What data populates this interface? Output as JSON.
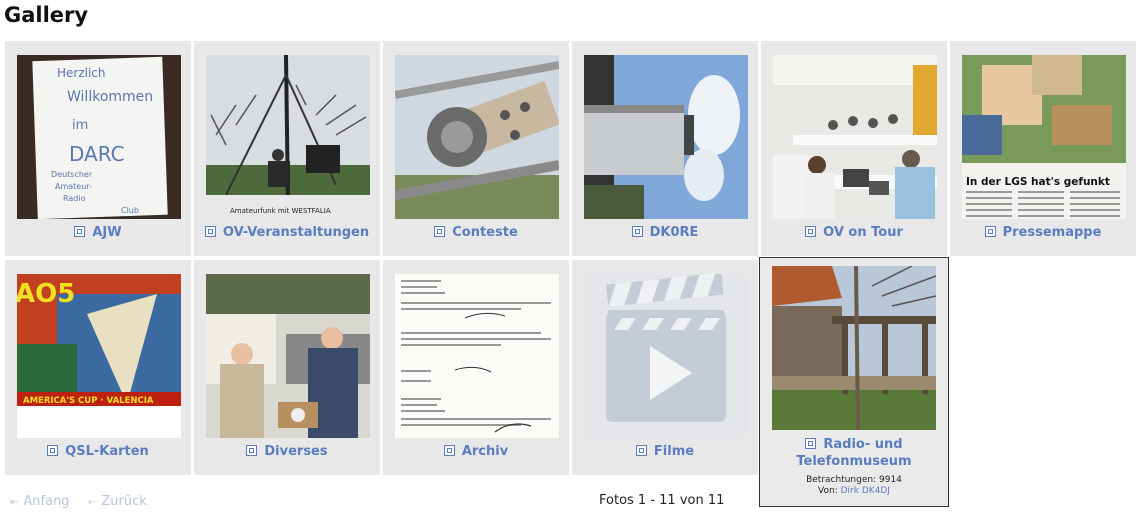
{
  "page": {
    "title": "Gallery"
  },
  "albums": [
    {
      "label": "AJW",
      "icon": "album-icon"
    },
    {
      "label": "OV-Veranstaltungen",
      "icon": "album-icon"
    },
    {
      "label": "Conteste",
      "icon": "album-icon"
    },
    {
      "label": "DK0RE",
      "icon": "album-icon"
    },
    {
      "label": "OV on Tour",
      "icon": "album-icon"
    },
    {
      "label": "Pressemappe",
      "icon": "album-icon"
    },
    {
      "label": "QSL-Karten",
      "icon": "album-icon"
    },
    {
      "label": "Diverses",
      "icon": "album-icon"
    },
    {
      "label": "Archiv",
      "icon": "album-icon"
    },
    {
      "label": "Filme",
      "icon": "album-icon"
    },
    {
      "label_line1": "Radio- und",
      "label_line2": "Telefonmuseum",
      "views_label": "Betrachtungen:",
      "views": "9914",
      "by_label": "Von:",
      "author": "Dirk DK4DJ",
      "icon": "album-icon"
    }
  ],
  "thumb_text": {
    "ajw": [
      "Herzlich",
      "Willkommen",
      "im",
      "DARC",
      "Deutscher",
      "Amateur-",
      "Radio",
      "Club"
    ],
    "ov_banner": "Amateurfunk mit WESTFALIA",
    "presse_headline": "In der LGS hat's gefunkt",
    "qsl_top": "AO5",
    "qsl_bottom": "AMERICA'S CUP · VALENCIA"
  },
  "pagination": {
    "first": "Anfang",
    "prev": "Zurück",
    "info": "Fotos 1 - 11 von 11"
  },
  "colors": {
    "link": "#5a7dbf",
    "cell_bg": "#e8e8e8",
    "nav_disabled": "#b8c6de"
  }
}
